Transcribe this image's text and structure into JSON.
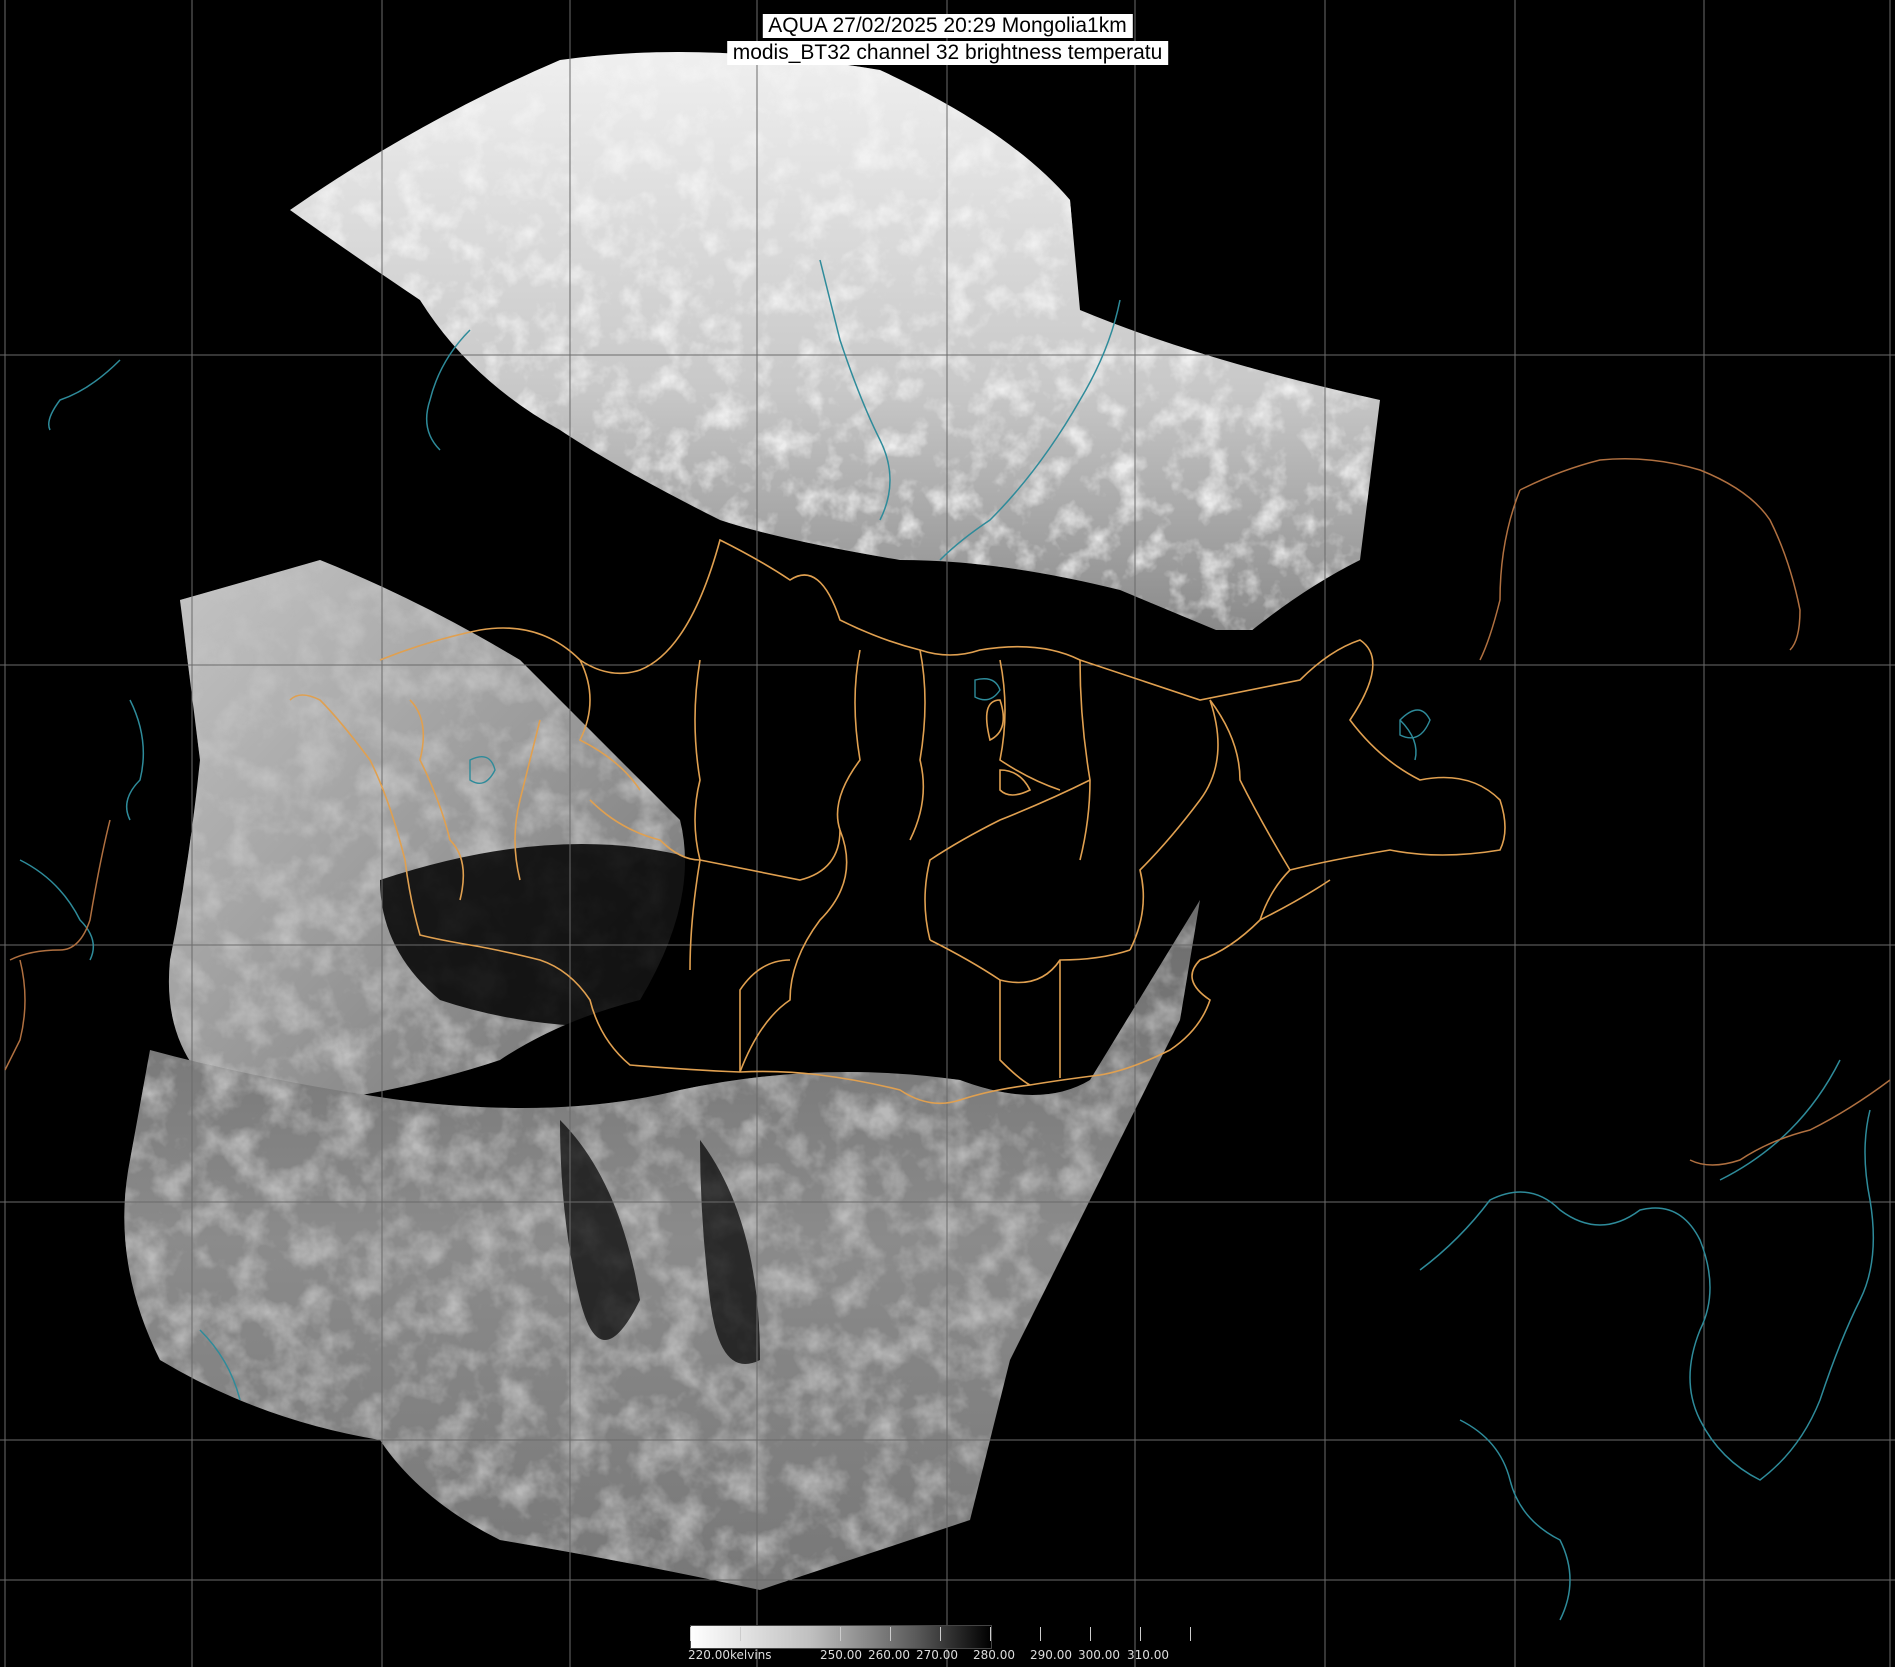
{
  "header": {
    "title_line1": "AQUA 27/02/2025 20:29 Mongolia1km",
    "title_line2": "modis_BT32 channel 32 brightness temperatu"
  },
  "legend": {
    "unit_label": "220.00kelvins",
    "labels": [
      "250.00",
      "260.00",
      "270.00",
      "280.00",
      "290.00",
      "300.00",
      "310.00"
    ]
  },
  "colors": {
    "background": "#000000",
    "graticule": "#6b6b6b",
    "admin_borders": "#e0a050",
    "coastlines_rivers": "#2e8b9a",
    "country_border_east": "#b07040"
  }
}
